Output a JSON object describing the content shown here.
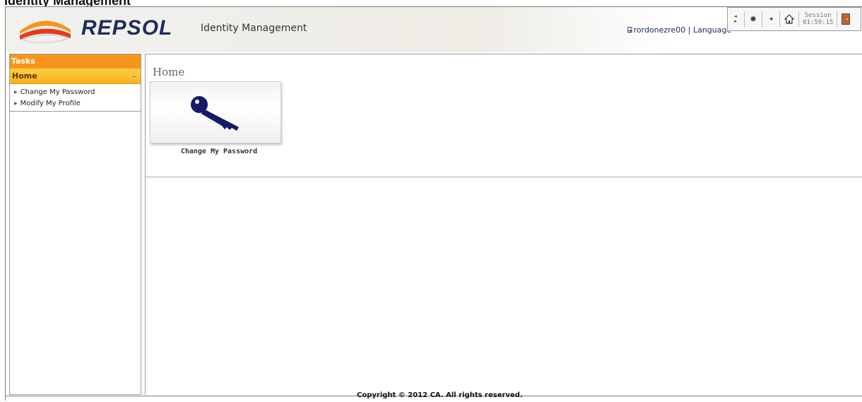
{
  "document_title": "Identity Management",
  "header": {
    "brand": "REPSOL",
    "app_name": "Identity Management",
    "user_name": "rordonezre00",
    "separator": "|",
    "language_label": "Language",
    "session_label": "Session",
    "session_time": "01:59:15",
    "icons": [
      "prev-next-icon",
      "compass-icon",
      "back-icon",
      "home-icon",
      "exit-icon"
    ]
  },
  "sidebar": {
    "tasks_label": "Tasks",
    "section_label": "Home",
    "items": [
      {
        "label": "Change My Password"
      },
      {
        "label": "Modify My Profile"
      }
    ]
  },
  "main": {
    "title": "Home",
    "tiles": [
      {
        "label": "Change My Password",
        "icon": "key-icon"
      }
    ]
  },
  "footer": {
    "copyright": "Copyright © 2012 CA. All rights reserved."
  },
  "colors": {
    "tasks_bar": "#f7941d",
    "home_bar": "#f8b21a",
    "brand_navy": "#1c2e5c",
    "key_blue": "#141a6a"
  }
}
